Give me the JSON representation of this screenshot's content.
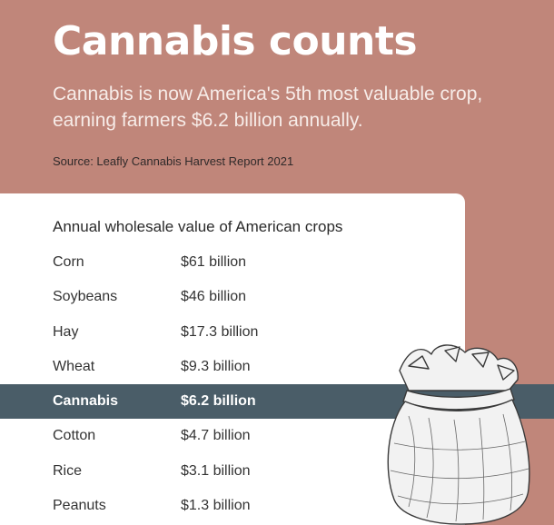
{
  "header": {
    "title": "Cannabis counts",
    "subtitle": "Cannabis is now America's 5th most valuable crop, earning farmers $6.2 billion annually.",
    "source": "Source: Leafly Cannabis Harvest Report 2021"
  },
  "colors": {
    "background": "#c0867a",
    "card": "#ffffff",
    "highlight_row": "#4a5d68"
  },
  "chart_data": {
    "type": "table",
    "title": "Annual wholesale value of American crops",
    "highlighted": "Cannabis",
    "rows": [
      {
        "crop": "Corn",
        "value": "$61 billion",
        "billions": 61
      },
      {
        "crop": "Soybeans",
        "value": "$46 billion",
        "billions": 46
      },
      {
        "crop": "Hay",
        "value": "$17.3 billion",
        "billions": 17.3
      },
      {
        "crop": "Wheat",
        "value": "$9.3 billion",
        "billions": 9.3
      },
      {
        "crop": "Cannabis",
        "value": "$6.2 billion",
        "billions": 6.2
      },
      {
        "crop": "Cotton",
        "value": "$4.7 billion",
        "billions": 4.7
      },
      {
        "crop": "Rice",
        "value": "$3.1 billion",
        "billions": 3.1
      },
      {
        "crop": "Peanuts",
        "value": "$1.3 billion",
        "billions": 1.3
      }
    ]
  },
  "illustration": {
    "icon": "sack-icon"
  }
}
